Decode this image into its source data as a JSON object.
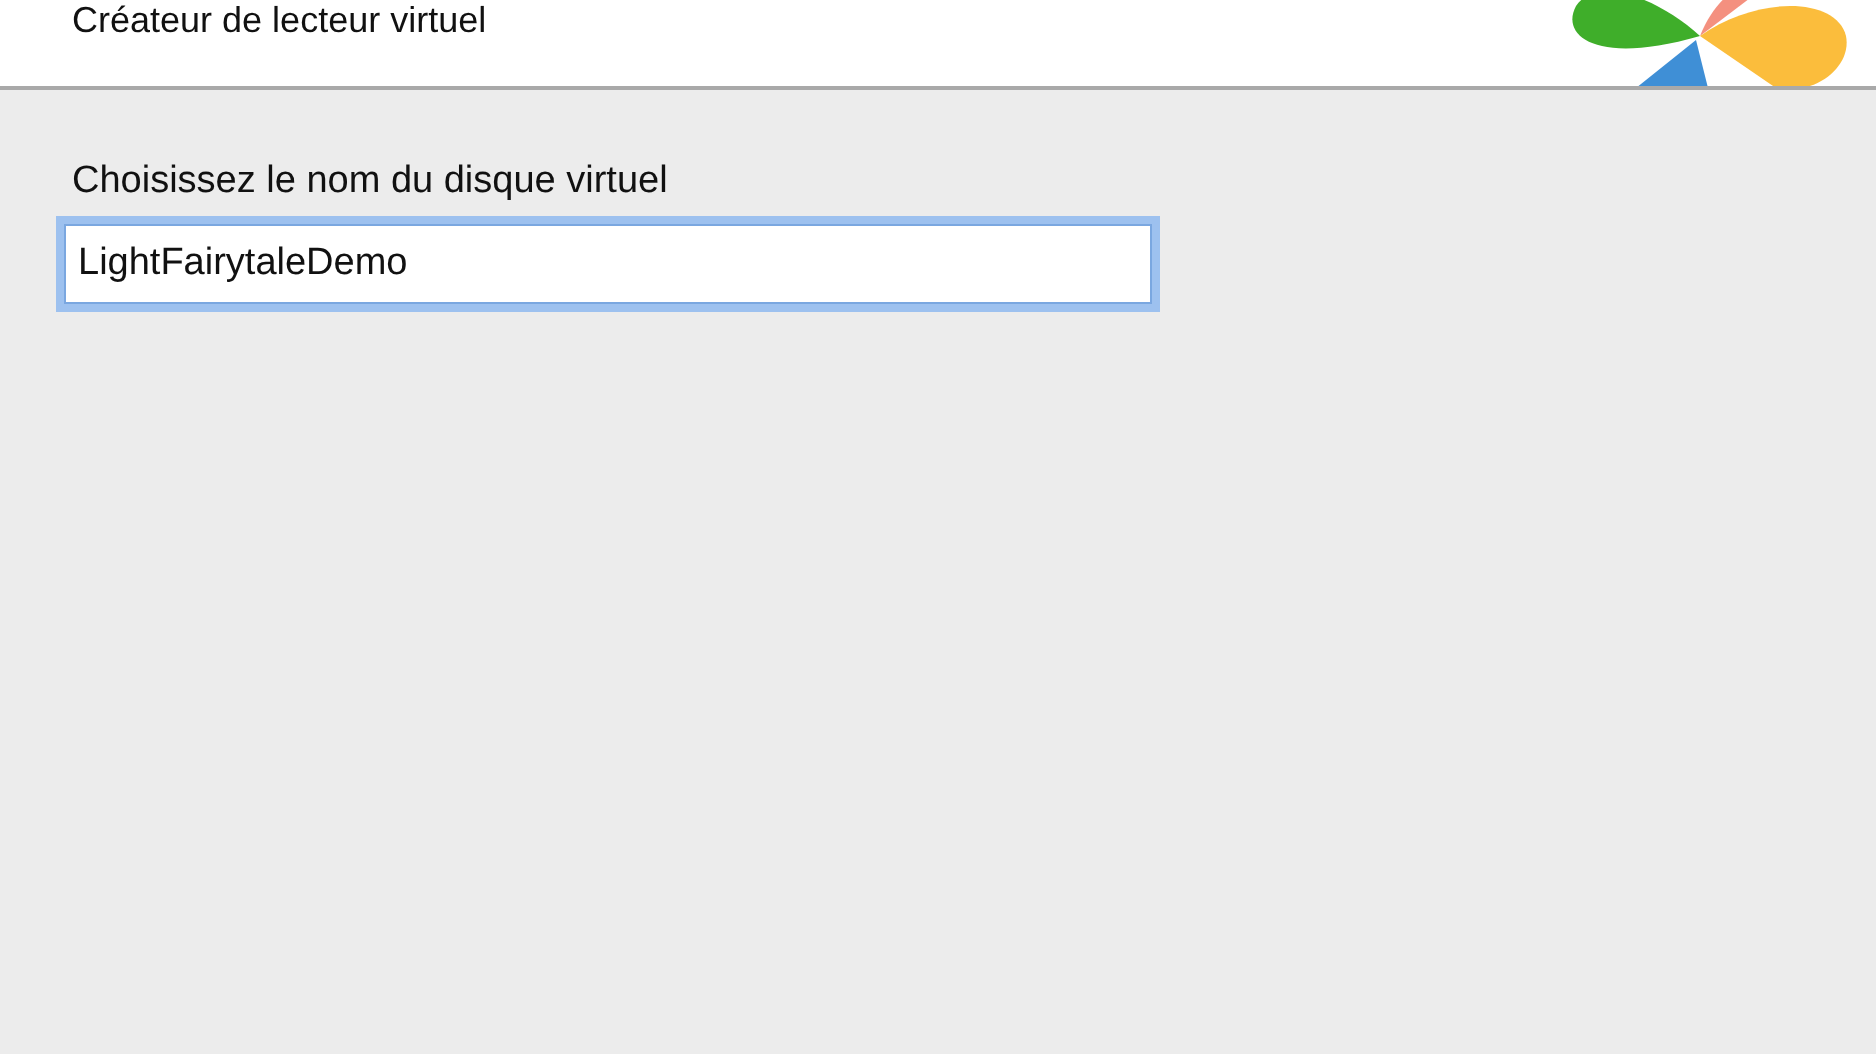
{
  "header": {
    "title": "Créateur de lecteur virtuel"
  },
  "form": {
    "label": "Choisissez le nom du disque virtuel",
    "value": "LightFairytaleDemo",
    "focused": true
  }
}
